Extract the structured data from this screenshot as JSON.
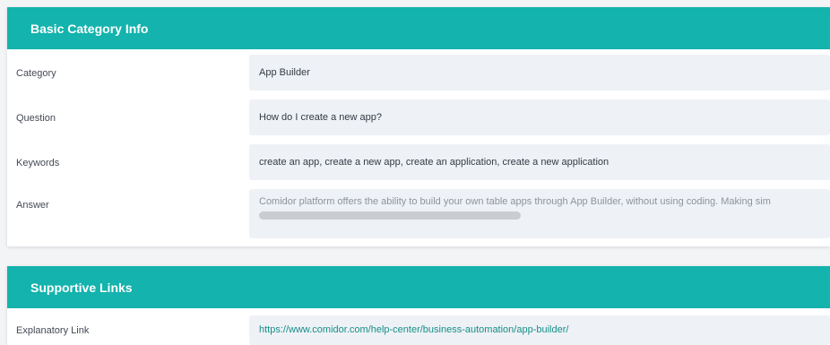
{
  "basic_info": {
    "header": "Basic Category Info",
    "fields": [
      {
        "label": "Category",
        "value": "App Builder"
      },
      {
        "label": "Question",
        "value": "How do I create a new app?"
      },
      {
        "label": "Keywords",
        "value": "create an app, create a new app, create an application, create a new application"
      },
      {
        "label": "Answer",
        "value": "Comidor platform offers the ability to build your own table apps through App Builder, without using coding. Making sim"
      }
    ]
  },
  "supportive_links": {
    "header": "Supportive Links",
    "fields": [
      {
        "label": "Explanatory Link",
        "value": "https://www.comidor.com/help-center/business-automation/app-builder/"
      }
    ]
  },
  "colors": {
    "header_bg": "#14b3ad",
    "value_bg": "#eef1f5",
    "link": "#168f8a"
  }
}
